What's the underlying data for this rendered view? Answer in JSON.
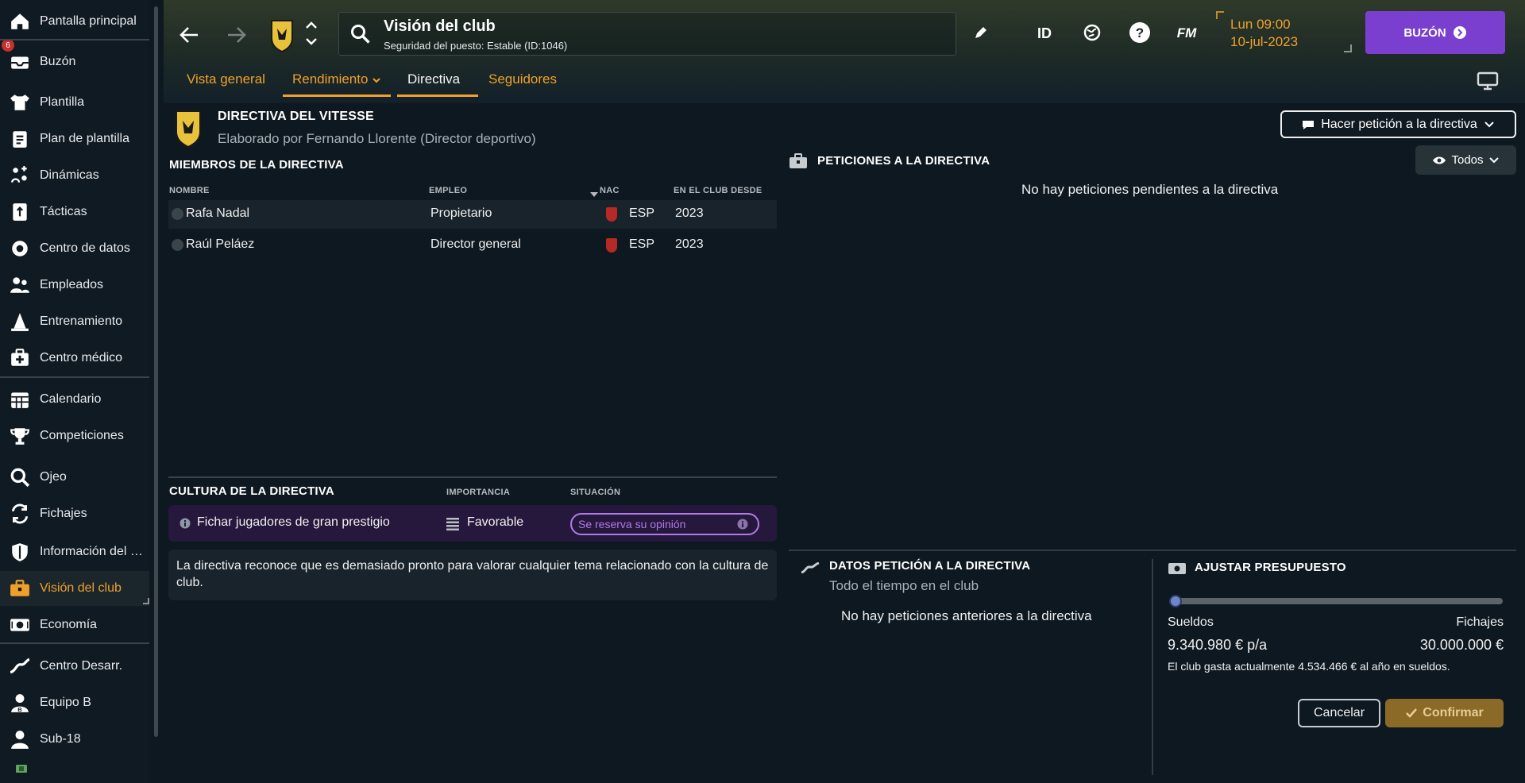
{
  "sidebar": {
    "items": [
      {
        "label": "Pantalla principal",
        "icon": "home-icon"
      },
      {
        "label": "Buzón",
        "icon": "inbox-icon",
        "badge": "6"
      },
      {
        "label": "Plantilla",
        "icon": "squad-shirt-icon"
      },
      {
        "label": "Plan de plantilla",
        "icon": "clipboard-icon"
      },
      {
        "label": "Dinámicas",
        "icon": "dynamics-icon"
      },
      {
        "label": "Tácticas",
        "icon": "tactics-icon"
      },
      {
        "label": "Centro de datos",
        "icon": "data-hub-icon"
      },
      {
        "label": "Empleados",
        "icon": "staff-icon"
      },
      {
        "label": "Entrenamiento",
        "icon": "training-cone-icon"
      },
      {
        "label": "Centro médico",
        "icon": "medical-kit-icon"
      },
      {
        "label": "Calendario",
        "icon": "calendar-icon"
      },
      {
        "label": "Competiciones",
        "icon": "trophy-icon"
      },
      {
        "label": "Ojeo",
        "icon": "magnifier-icon"
      },
      {
        "label": "Fichajes",
        "icon": "transfer-arrows-icon"
      },
      {
        "label": "Información del cl...",
        "icon": "club-shield-icon"
      },
      {
        "label": "Visión del club",
        "icon": "briefcase-icon"
      },
      {
        "label": "Economía",
        "icon": "money-icon"
      },
      {
        "label": "Centro Desarr.",
        "icon": "development-icon"
      },
      {
        "label": "Equipo B",
        "icon": "team-b-icon"
      },
      {
        "label": "Sub-18",
        "icon": "u18-icon"
      }
    ]
  },
  "header": {
    "title": "Visión del club",
    "subtitle": "Seguridad del puesto: Estable (ID:1046)",
    "icons": {
      "id": "ID",
      "fm": "FM"
    },
    "date_line1": "Lun 09:00",
    "date_line2": "10-jul-2023",
    "inbox_label": "BUZÓN",
    "tabs": [
      {
        "label": "Vista general"
      },
      {
        "label": "Rendimiento"
      },
      {
        "label": "Directiva"
      },
      {
        "label": "Seguidores"
      }
    ]
  },
  "board": {
    "title": "DIRECTIVA DEL VITESSE",
    "author": "Elaborado por Fernando Llorente (Director deportivo)",
    "members_title": "MIEMBROS DE LA DIRECTIVA",
    "columns": {
      "name": "NOMBRE",
      "job": "EMPLEO",
      "nat": "NAC",
      "since": "EN EL CLUB DESDE"
    },
    "members": [
      {
        "name": "Rafa Nadal",
        "job": "Propietario",
        "nat": "ESP",
        "since": "2023"
      },
      {
        "name": "Raúl Peláez",
        "job": "Director general",
        "nat": "ESP",
        "since": "2023"
      }
    ]
  },
  "culture": {
    "title": "CULTURA DE LA DIRECTIVA",
    "col_importance": "IMPORTANCIA",
    "col_situation": "SITUACIÓN",
    "item": "Fichar jugadores de gran prestigio",
    "importance": "Favorable",
    "situation": "Se reserva su opinión",
    "note": "La directiva reconoce que es demasiado pronto para valorar cualquier tema relacionado con la cultura de club."
  },
  "requests": {
    "button_label": "Hacer petición a la directiva",
    "title": "PETICIONES A LA DIRECTIVA",
    "filter_label": "Todos",
    "empty_text": "No hay peticiones pendientes a la directiva"
  },
  "history": {
    "title": "DATOS PETICIÓN A LA DIRECTIVA",
    "subtitle": "Todo el tiempo en el club",
    "empty_text": "No hay peticiones anteriores a la directiva"
  },
  "budget": {
    "title": "AJUSTAR PRESUPUESTO",
    "wages_label": "Sueldos",
    "transfers_label": "Fichajes",
    "wages_value": "9.340.980 € p/a",
    "transfers_value": "30.000.000 €",
    "note": "El club gasta actualmente 4.534.466 € al año en sueldos.",
    "slider_fraction": 0.0,
    "cancel_label": "Cancelar",
    "confirm_label": "Confirmar"
  },
  "colors": {
    "accent": "#f0a02a",
    "inbox": "#7b3fd0",
    "opinion": "#b27ae6",
    "culture_bg": "#26173d"
  }
}
